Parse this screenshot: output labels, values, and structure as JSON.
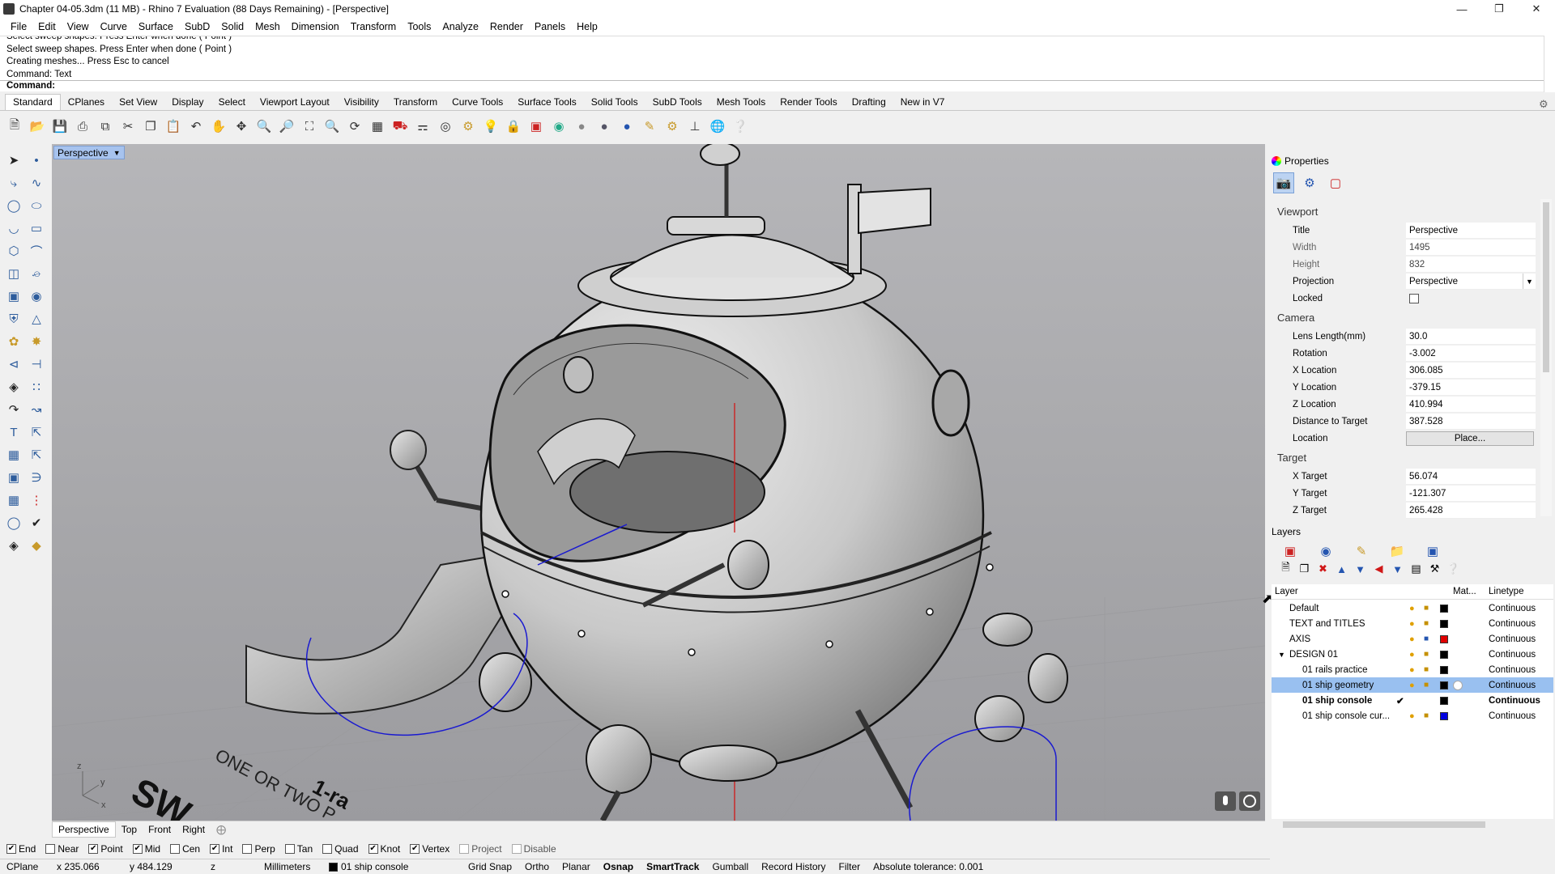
{
  "window": {
    "title": "Chapter 04-05.3dm (11 MB) - Rhino 7 Evaluation (88 Days Remaining) - [Perspective]"
  },
  "menu": [
    "File",
    "Edit",
    "View",
    "Curve",
    "Surface",
    "SubD",
    "Solid",
    "Mesh",
    "Dimension",
    "Transform",
    "Tools",
    "Analyze",
    "Render",
    "Panels",
    "Help"
  ],
  "command_history": [
    "Select sweep shapes. Press Enter when done ( Point )",
    "Select sweep shapes. Press Enter when done ( Point )",
    "Creating meshes... Press Esc to cancel",
    "Command: Text"
  ],
  "command_prompt": "Command:",
  "toolbar_tabs": [
    "Standard",
    "CPlanes",
    "Set View",
    "Display",
    "Select",
    "Viewport Layout",
    "Visibility",
    "Transform",
    "Curve Tools",
    "Surface Tools",
    "Solid Tools",
    "SubD Tools",
    "Mesh Tools",
    "Render Tools",
    "Drafting",
    "New in V7"
  ],
  "toolbar_icons": [
    "new-icon",
    "open-icon",
    "save-icon",
    "print-icon",
    "import-icon",
    "cut-icon",
    "copy-icon",
    "paste-icon",
    "undo-icon",
    "pan-icon",
    "move-view-icon",
    "zoom-icon",
    "zoom-window-icon",
    "zoom-extents-icon",
    "zoom-selected-icon",
    "rotate-view-icon",
    "four-view-icon",
    "car-icon",
    "options-icon",
    "cplane-icon",
    "grid-icon",
    "bulb-icon",
    "lock-icon",
    "layer-icon",
    "color-icon",
    "render-sphere-icon",
    "shaded-sphere-icon",
    "rendered-sphere-icon",
    "paint-icon",
    "gear-icon",
    "dimension-icon",
    "globe-icon",
    "help-icon"
  ],
  "viewport": {
    "label": "Perspective",
    "axes": {
      "z": "z",
      "y": "y",
      "x": "x"
    },
    "model_text_1": "ONE OR TWO P",
    "model_text_2": "SW",
    "model_text_3": "1-ra"
  },
  "viewport_tabs": [
    "Perspective",
    "Top",
    "Front",
    "Right"
  ],
  "osnaps": [
    {
      "label": "End",
      "checked": true
    },
    {
      "label": "Near",
      "checked": false
    },
    {
      "label": "Point",
      "checked": true
    },
    {
      "label": "Mid",
      "checked": true
    },
    {
      "label": "Cen",
      "checked": false
    },
    {
      "label": "Int",
      "checked": true
    },
    {
      "label": "Perp",
      "checked": false
    },
    {
      "label": "Tan",
      "checked": false
    },
    {
      "label": "Quad",
      "checked": false
    },
    {
      "label": "Knot",
      "checked": true
    },
    {
      "label": "Vertex",
      "checked": true
    },
    {
      "label": "Project",
      "checked": false
    },
    {
      "label": "Disable",
      "checked": false
    }
  ],
  "status": {
    "cplane": "CPlane",
    "x": "x 235.066",
    "y": "y 484.129",
    "z": "z",
    "units": "Millimeters",
    "layer": "01 ship console",
    "grid_snap": "Grid Snap",
    "ortho": "Ortho",
    "planar": "Planar",
    "osnap": "Osnap",
    "smarttrack": "SmartTrack",
    "gumball": "Gumball",
    "record_history": "Record History",
    "filter": "Filter",
    "tolerance": "Absolute tolerance: 0.001"
  },
  "properties": {
    "title": "Properties",
    "viewport_section": "Viewport",
    "viewport_rows": [
      {
        "k": "Title",
        "v": "Perspective"
      },
      {
        "k": "Width",
        "v": "1495"
      },
      {
        "k": "Height",
        "v": "832"
      }
    ],
    "projection": {
      "k": "Projection",
      "v": "Perspective"
    },
    "locked": {
      "k": "Locked"
    },
    "camera_section": "Camera",
    "camera_rows": [
      {
        "k": "Lens Length(mm)",
        "v": "30.0"
      },
      {
        "k": "Rotation",
        "v": "-3.002"
      },
      {
        "k": "X Location",
        "v": "306.085"
      },
      {
        "k": "Y Location",
        "v": "-379.15"
      },
      {
        "k": "Z Location",
        "v": "410.994"
      },
      {
        "k": "Distance to Target",
        "v": "387.528"
      }
    ],
    "location": {
      "k": "Location",
      "btn": "Place..."
    },
    "target_section": "Target",
    "target_rows": [
      {
        "k": "X Target",
        "v": "56.074"
      },
      {
        "k": "Y Target",
        "v": "-121.307"
      },
      {
        "k": "Z Target",
        "v": "265.428"
      }
    ]
  },
  "layers": {
    "title": "Layers",
    "headers": {
      "layer": "Layer",
      "material": "Mat...",
      "linetype": "Linetype"
    },
    "rows": [
      {
        "name": "Default",
        "color": "#000000",
        "linetype": "Continuous"
      },
      {
        "name": "TEXT and TITLES",
        "color": "#000000",
        "linetype": "Continuous"
      },
      {
        "name": "AXIS",
        "color": "#e00000",
        "linetype": "Continuous"
      },
      {
        "name": "DESIGN 01",
        "color": "#000000",
        "linetype": "Continuous",
        "expanded": true
      },
      {
        "name": "01 rails practice",
        "color": "#000000",
        "linetype": "Continuous"
      },
      {
        "name": "01 ship geometry",
        "color": "#000000",
        "linetype": "Continuous",
        "selected": true
      },
      {
        "name": "01 ship console",
        "color": "#000000",
        "linetype": "Continuous",
        "current": true
      },
      {
        "name": "01 ship console cur...",
        "color": "#0000e0",
        "linetype": "Continuous"
      }
    ]
  },
  "colors": {
    "viewport_label_bg": "#a7c3ee",
    "selection": "#99c0f0",
    "curve_blue": "#1a1ad0",
    "axis_red": "#d01818"
  }
}
